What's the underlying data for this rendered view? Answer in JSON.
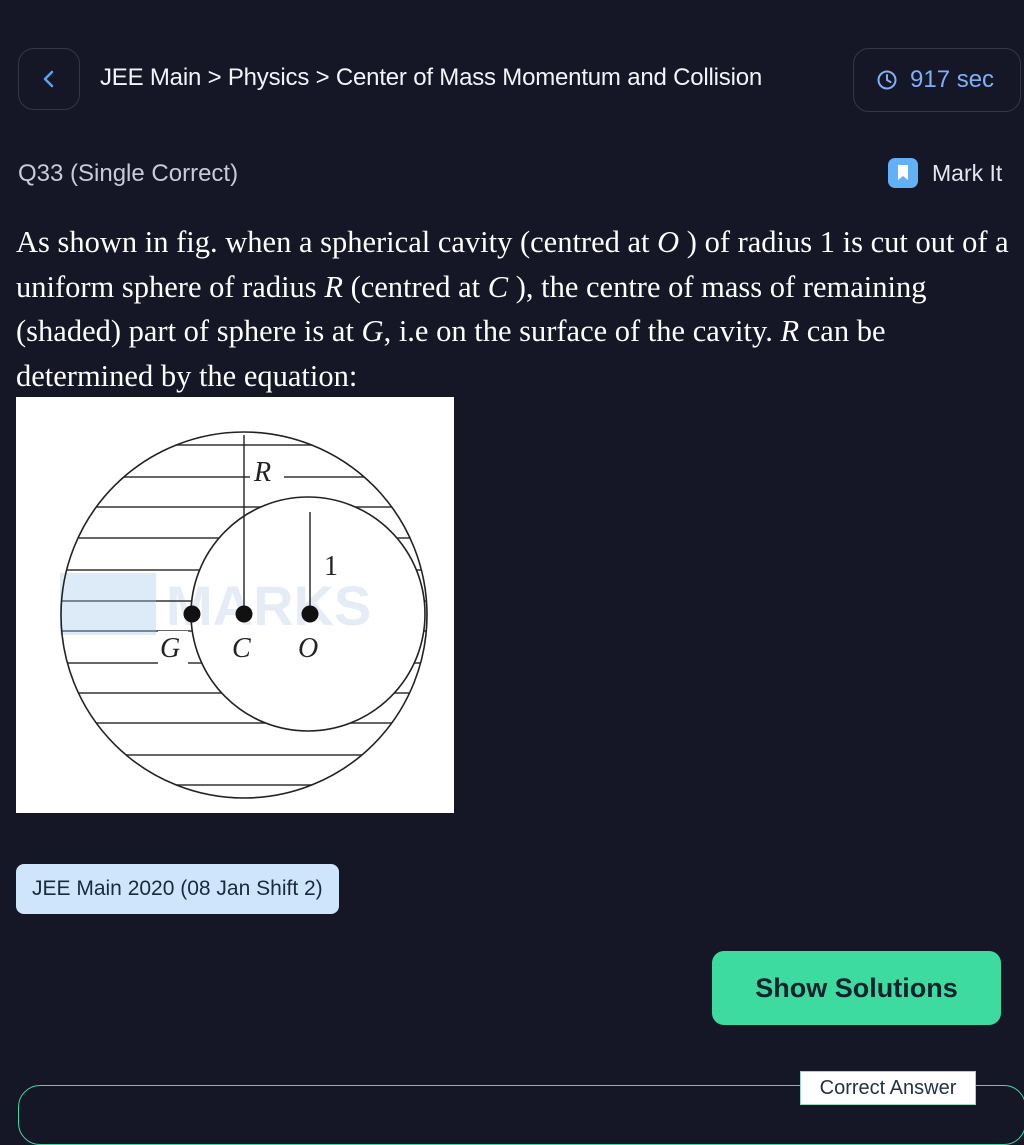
{
  "header": {
    "breadcrumb": "JEE Main > Physics > Center of Mass Momentum and Collision",
    "timer": "917 sec"
  },
  "question": {
    "label": "Q33 (Single Correct)",
    "mark_label": "Mark It",
    "text": {
      "p1": "As shown in fig. when a spherical cavity (centred at ",
      "O": "O",
      "p2": " ) of radius 1 is cut out of a uniform sphere of radius ",
      "R": "R",
      "p3": " (centred at ",
      "C": "C",
      "p4": " ), the centre of mass of remaining (shaded) part of sphere is at ",
      "G": "G",
      "p5": ", i.e on the surface of the cavity. ",
      "R2": "R",
      "p6": " can be determined by the equation:"
    },
    "figure": {
      "label_R": "R",
      "label_1": "1",
      "label_G": "G",
      "label_C": "C",
      "label_O": "O",
      "watermark": "MARKS"
    },
    "exam_tag": "JEE Main 2020 (08 Jan Shift 2)"
  },
  "actions": {
    "show_solutions": "Show Solutions",
    "correct_answer": "Correct Answer"
  },
  "colors": {
    "background": "#161726",
    "accent_green": "#3ddba0",
    "accent_blue": "#62b0f5",
    "tag_bg": "#cfe5fb"
  },
  "icons": {
    "back": "chevron-left-icon",
    "timer": "clock-icon",
    "mark": "bookmark-icon"
  }
}
